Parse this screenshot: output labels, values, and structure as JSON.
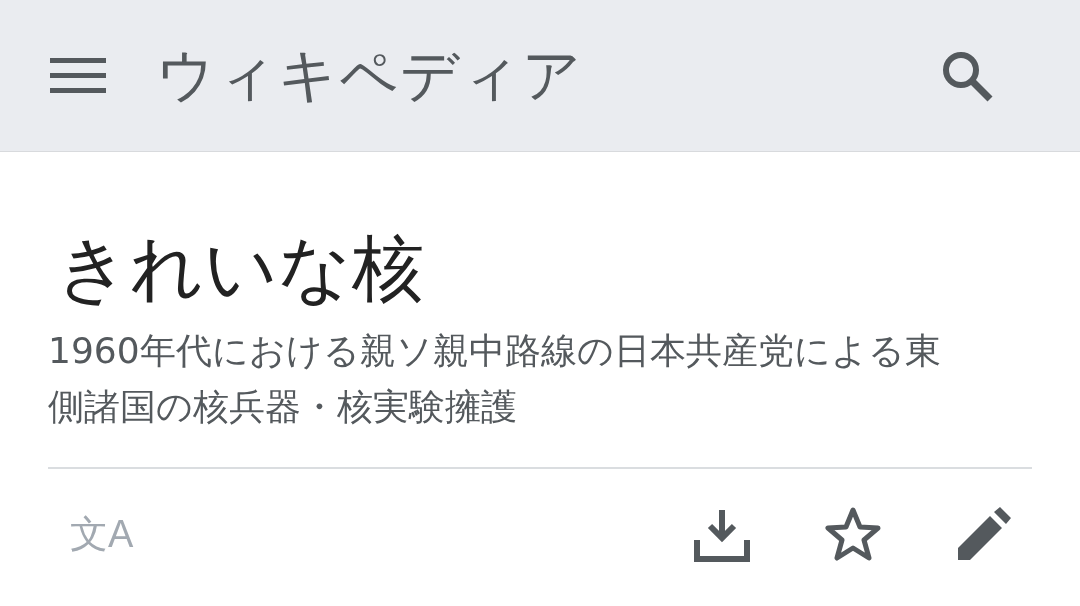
{
  "header": {
    "logo": "ウィキペディア"
  },
  "article": {
    "title": "きれいな核",
    "description": "1960年代における親ソ親中路線の日本共産党による東側諸国の核兵器・核実験擁護"
  },
  "toolbar": {
    "language_label": "文A",
    "actions": [
      {
        "kind": "download"
      },
      {
        "kind": "star"
      },
      {
        "kind": "edit"
      }
    ]
  }
}
